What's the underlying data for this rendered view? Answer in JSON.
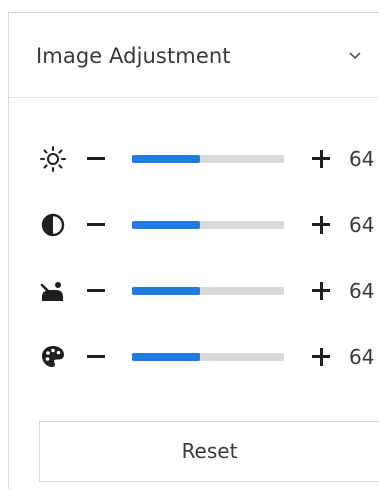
{
  "panel": {
    "title": "Image Adjustment",
    "collapse_icon": "chevron-down-icon"
  },
  "adjustments": [
    {
      "key": "brightness",
      "icon": "brightness-icon",
      "value": "64",
      "level_percent": 45
    },
    {
      "key": "contrast",
      "icon": "contrast-icon",
      "value": "64",
      "level_percent": 45
    },
    {
      "key": "saturation",
      "icon": "saturation-icon",
      "value": "64",
      "level_percent": 45
    },
    {
      "key": "hue",
      "icon": "palette-icon",
      "value": "64",
      "level_percent": 45
    }
  ],
  "reset_label": "Reset",
  "colors": {
    "accent": "#1f7be0",
    "track": "#d9d9d9",
    "icon": "#1f1f1f"
  }
}
